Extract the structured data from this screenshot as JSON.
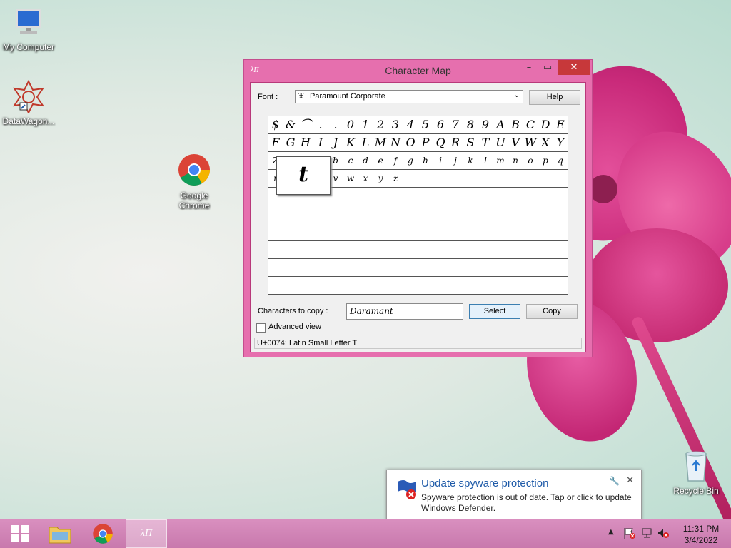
{
  "desktop": {
    "icons": [
      {
        "label": "My Computer"
      },
      {
        "label": "DataWagon..."
      },
      {
        "label": "Google Chrome"
      },
      {
        "label": "Recycle Bin"
      }
    ]
  },
  "window": {
    "title": "Character Map",
    "font_label": "Font :",
    "font_value": "Paramount Corporate",
    "help_label": "Help",
    "grid_rows": [
      [
        "$",
        "&",
        "⌒",
        ".",
        ".",
        "0",
        "1",
        "2",
        "3",
        "4",
        "5",
        "6",
        "7",
        "8",
        "9",
        "A",
        "B",
        "C",
        "D",
        "E"
      ],
      [
        "F",
        "G",
        "H",
        "I",
        "J",
        "K",
        "L",
        "M",
        "N",
        "O",
        "P",
        "Q",
        "R",
        "S",
        "T",
        "U",
        "V",
        "W",
        "X",
        "Y"
      ],
      [
        "Z",
        "i",
        "j",
        "a",
        "b",
        "c",
        "d",
        "e",
        "f",
        "g",
        "h",
        "i",
        "j",
        "k",
        "l",
        "m",
        "n",
        "o",
        "p",
        "q"
      ],
      [
        "r",
        "s",
        "t",
        "u",
        "v",
        "w",
        "x",
        "y",
        "z",
        "",
        "",
        "",
        "",
        "",
        "",
        "",
        "",
        "",
        "",
        ""
      ],
      [
        "",
        "",
        "",
        "",
        "",
        "",
        "",
        "",
        "",
        "",
        "",
        "",
        "",
        "",
        "",
        "",
        "",
        "",
        "",
        ""
      ],
      [
        "",
        "",
        "",
        "",
        "",
        "",
        "",
        "",
        "",
        "",
        "",
        "",
        "",
        "",
        "",
        "",
        "",
        "",
        "",
        ""
      ],
      [
        "",
        "",
        "",
        "",
        "",
        "",
        "",
        "",
        "",
        "",
        "",
        "",
        "",
        "",
        "",
        "",
        "",
        "",
        "",
        ""
      ],
      [
        "",
        "",
        "",
        "",
        "",
        "",
        "",
        "",
        "",
        "",
        "",
        "",
        "",
        "",
        "",
        "",
        "",
        "",
        "",
        ""
      ],
      [
        "",
        "",
        "",
        "",
        "",
        "",
        "",
        "",
        "",
        "",
        "",
        "",
        "",
        "",
        "",
        "",
        "",
        "",
        "",
        ""
      ],
      [
        "",
        "",
        "",
        "",
        "",
        "",
        "",
        "",
        "",
        "",
        "",
        "",
        "",
        "",
        "",
        "",
        "",
        "",
        "",
        ""
      ]
    ],
    "zoom_char": "t",
    "chars_to_copy_label": "Characters to copy :",
    "chars_to_copy_value": "Daramant",
    "select_label": "Select",
    "copy_label": "Copy",
    "advanced_view_label": "Advanced view",
    "status_text": "U+0074: Latin Small Letter T"
  },
  "toast": {
    "title": "Update spyware protection",
    "body_line1": "Spyware protection is out of date. Tap or click to update",
    "body_line2": "Windows Defender."
  },
  "clock": {
    "time": "11:31 PM",
    "date": "3/4/2022"
  },
  "colors": {
    "window_frame": "#e66fae",
    "taskbar": "#c879ad",
    "toast_title": "#1e5aa8"
  }
}
